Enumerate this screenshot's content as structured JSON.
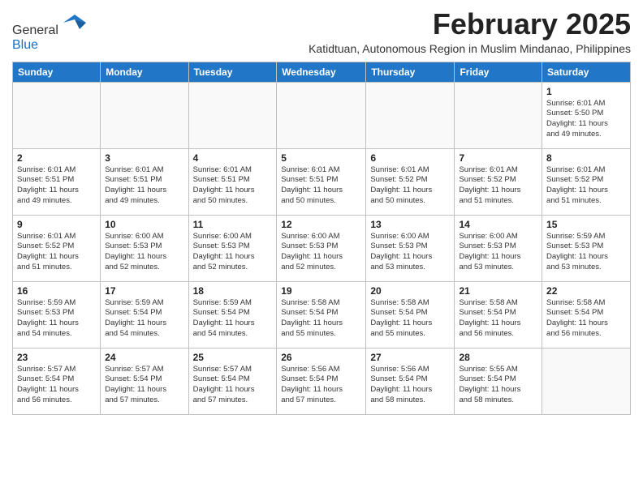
{
  "logo": {
    "line1": "General",
    "line2": "Blue"
  },
  "title": "February 2025",
  "subtitle": "Katidtuan, Autonomous Region in Muslim Mindanao, Philippines",
  "days_of_week": [
    "Sunday",
    "Monday",
    "Tuesday",
    "Wednesday",
    "Thursday",
    "Friday",
    "Saturday"
  ],
  "weeks": [
    [
      {
        "day": "",
        "info": ""
      },
      {
        "day": "",
        "info": ""
      },
      {
        "day": "",
        "info": ""
      },
      {
        "day": "",
        "info": ""
      },
      {
        "day": "",
        "info": ""
      },
      {
        "day": "",
        "info": ""
      },
      {
        "day": "1",
        "info": "Sunrise: 6:01 AM\nSunset: 5:50 PM\nDaylight: 11 hours\nand 49 minutes."
      }
    ],
    [
      {
        "day": "2",
        "info": "Sunrise: 6:01 AM\nSunset: 5:51 PM\nDaylight: 11 hours\nand 49 minutes."
      },
      {
        "day": "3",
        "info": "Sunrise: 6:01 AM\nSunset: 5:51 PM\nDaylight: 11 hours\nand 49 minutes."
      },
      {
        "day": "4",
        "info": "Sunrise: 6:01 AM\nSunset: 5:51 PM\nDaylight: 11 hours\nand 50 minutes."
      },
      {
        "day": "5",
        "info": "Sunrise: 6:01 AM\nSunset: 5:51 PM\nDaylight: 11 hours\nand 50 minutes."
      },
      {
        "day": "6",
        "info": "Sunrise: 6:01 AM\nSunset: 5:52 PM\nDaylight: 11 hours\nand 50 minutes."
      },
      {
        "day": "7",
        "info": "Sunrise: 6:01 AM\nSunset: 5:52 PM\nDaylight: 11 hours\nand 51 minutes."
      },
      {
        "day": "8",
        "info": "Sunrise: 6:01 AM\nSunset: 5:52 PM\nDaylight: 11 hours\nand 51 minutes."
      }
    ],
    [
      {
        "day": "9",
        "info": "Sunrise: 6:01 AM\nSunset: 5:52 PM\nDaylight: 11 hours\nand 51 minutes."
      },
      {
        "day": "10",
        "info": "Sunrise: 6:00 AM\nSunset: 5:53 PM\nDaylight: 11 hours\nand 52 minutes."
      },
      {
        "day": "11",
        "info": "Sunrise: 6:00 AM\nSunset: 5:53 PM\nDaylight: 11 hours\nand 52 minutes."
      },
      {
        "day": "12",
        "info": "Sunrise: 6:00 AM\nSunset: 5:53 PM\nDaylight: 11 hours\nand 52 minutes."
      },
      {
        "day": "13",
        "info": "Sunrise: 6:00 AM\nSunset: 5:53 PM\nDaylight: 11 hours\nand 53 minutes."
      },
      {
        "day": "14",
        "info": "Sunrise: 6:00 AM\nSunset: 5:53 PM\nDaylight: 11 hours\nand 53 minutes."
      },
      {
        "day": "15",
        "info": "Sunrise: 5:59 AM\nSunset: 5:53 PM\nDaylight: 11 hours\nand 53 minutes."
      }
    ],
    [
      {
        "day": "16",
        "info": "Sunrise: 5:59 AM\nSunset: 5:53 PM\nDaylight: 11 hours\nand 54 minutes."
      },
      {
        "day": "17",
        "info": "Sunrise: 5:59 AM\nSunset: 5:54 PM\nDaylight: 11 hours\nand 54 minutes."
      },
      {
        "day": "18",
        "info": "Sunrise: 5:59 AM\nSunset: 5:54 PM\nDaylight: 11 hours\nand 54 minutes."
      },
      {
        "day": "19",
        "info": "Sunrise: 5:58 AM\nSunset: 5:54 PM\nDaylight: 11 hours\nand 55 minutes."
      },
      {
        "day": "20",
        "info": "Sunrise: 5:58 AM\nSunset: 5:54 PM\nDaylight: 11 hours\nand 55 minutes."
      },
      {
        "day": "21",
        "info": "Sunrise: 5:58 AM\nSunset: 5:54 PM\nDaylight: 11 hours\nand 56 minutes."
      },
      {
        "day": "22",
        "info": "Sunrise: 5:58 AM\nSunset: 5:54 PM\nDaylight: 11 hours\nand 56 minutes."
      }
    ],
    [
      {
        "day": "23",
        "info": "Sunrise: 5:57 AM\nSunset: 5:54 PM\nDaylight: 11 hours\nand 56 minutes."
      },
      {
        "day": "24",
        "info": "Sunrise: 5:57 AM\nSunset: 5:54 PM\nDaylight: 11 hours\nand 57 minutes."
      },
      {
        "day": "25",
        "info": "Sunrise: 5:57 AM\nSunset: 5:54 PM\nDaylight: 11 hours\nand 57 minutes."
      },
      {
        "day": "26",
        "info": "Sunrise: 5:56 AM\nSunset: 5:54 PM\nDaylight: 11 hours\nand 57 minutes."
      },
      {
        "day": "27",
        "info": "Sunrise: 5:56 AM\nSunset: 5:54 PM\nDaylight: 11 hours\nand 58 minutes."
      },
      {
        "day": "28",
        "info": "Sunrise: 5:55 AM\nSunset: 5:54 PM\nDaylight: 11 hours\nand 58 minutes."
      },
      {
        "day": "",
        "info": ""
      }
    ]
  ]
}
